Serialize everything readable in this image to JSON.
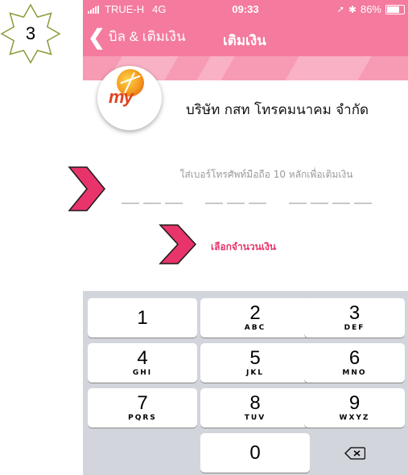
{
  "step_badge": {
    "number": "3"
  },
  "status_bar": {
    "carrier": "TRUE-H",
    "network": "4G",
    "time": "09:33",
    "battery": "86%",
    "battery_level": 0.86
  },
  "navbar": {
    "back_label": "บิล & เติมเงิน",
    "title": "เติมเงิน"
  },
  "brand": {
    "logo_text": "my",
    "company_name": "บริษัท กสท โทรคมนาคม จำกัด"
  },
  "form": {
    "prompt": "ใส่เบอร์โทรศัพท์มือถือ 10 หลักเพื่อเติมเงิน",
    "phone_digits": [
      "",
      "",
      "",
      "",
      "",
      "",
      "",
      "",
      "",
      ""
    ],
    "select_amount_label": "เลือกจำนวนเงิน"
  },
  "keypad": {
    "keys": [
      {
        "digit": "1",
        "letters": ""
      },
      {
        "digit": "2",
        "letters": "ABC"
      },
      {
        "digit": "3",
        "letters": "DEF"
      },
      {
        "digit": "4",
        "letters": "GHI"
      },
      {
        "digit": "5",
        "letters": "JKL"
      },
      {
        "digit": "6",
        "letters": "MNO"
      },
      {
        "digit": "7",
        "letters": "PQRS"
      },
      {
        "digit": "8",
        "letters": "TUV"
      },
      {
        "digit": "9",
        "letters": "WXYZ"
      },
      {
        "digit": "0",
        "letters": ""
      }
    ],
    "delete_icon": "backspace-icon"
  },
  "colors": {
    "accent": "#f47a9e",
    "arrow": "#e8346a",
    "link": "#e8346a",
    "keypad_bg": "#d2d5db"
  }
}
